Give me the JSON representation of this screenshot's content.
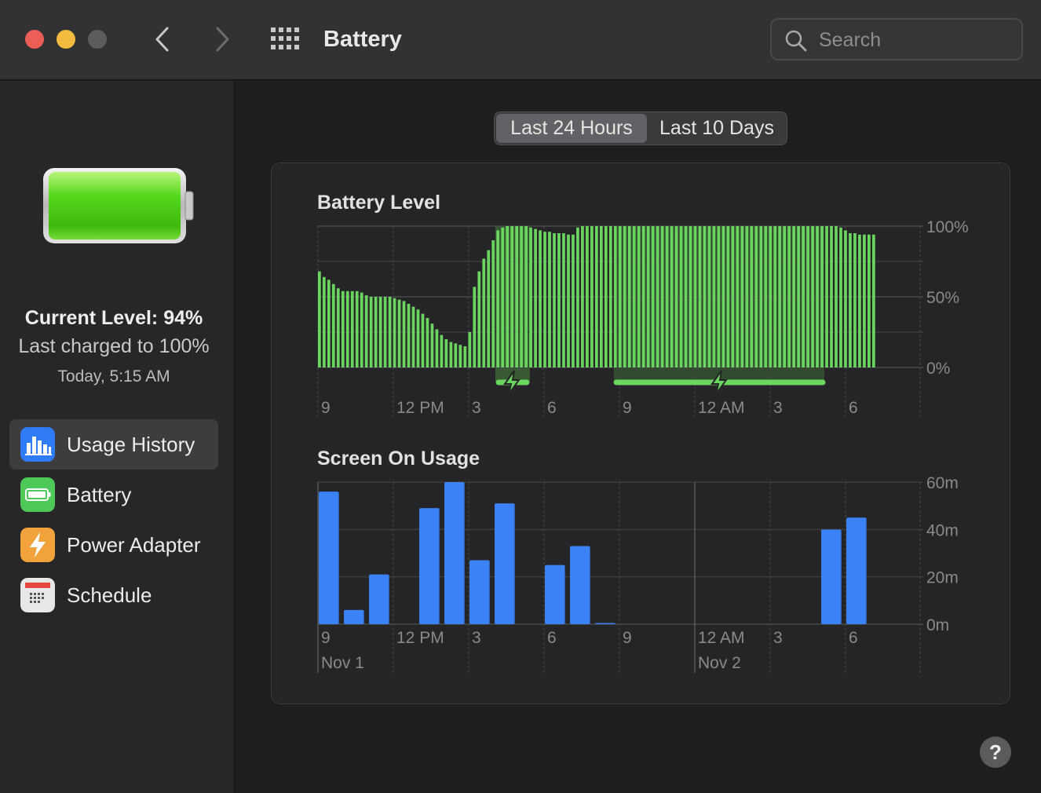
{
  "window": {
    "title": "Battery"
  },
  "search": {
    "placeholder": "Search"
  },
  "sidebar": {
    "current_level": "Current Level: 94%",
    "last_charged": "Last charged to 100%",
    "charged_time": "Today, 5:15 AM",
    "items": [
      {
        "label": "Usage History",
        "icon": "usage-history-icon",
        "active": true
      },
      {
        "label": "Battery",
        "icon": "battery-icon",
        "active": false
      },
      {
        "label": "Power Adapter",
        "icon": "power-adapter-icon",
        "active": false
      },
      {
        "label": "Schedule",
        "icon": "schedule-icon",
        "active": false
      }
    ]
  },
  "tabs": [
    {
      "label": "Last 24 Hours",
      "selected": true
    },
    {
      "label": "Last 10 Days",
      "selected": false
    }
  ],
  "help": {
    "label": "?"
  },
  "chart_data": [
    {
      "type": "bar",
      "title": "Battery Level",
      "ylabel": "",
      "ylim": [
        0,
        100
      ],
      "y_ticks": [
        "100%",
        "50%",
        "0%"
      ],
      "x_ticks": [
        "9",
        "12 PM",
        "3",
        "6",
        "9",
        "12 AM",
        "3",
        "6"
      ],
      "bar_color": "#6ad55f",
      "values": [
        68,
        64,
        62,
        59,
        56,
        54,
        54,
        54,
        54,
        53,
        51,
        50,
        50,
        50,
        50,
        50,
        49,
        48,
        47,
        45,
        43,
        41,
        38,
        35,
        31,
        27,
        23,
        20,
        18,
        17,
        16,
        15,
        25,
        57,
        68,
        77,
        83,
        90,
        97,
        99,
        100,
        100,
        100,
        100,
        100,
        99,
        98,
        97,
        96,
        96,
        95,
        95,
        95,
        94,
        94,
        99,
        100,
        100,
        100,
        100,
        100,
        100,
        100,
        100,
        100,
        100,
        100,
        100,
        100,
        100,
        100,
        100,
        100,
        100,
        100,
        100,
        100,
        100,
        100,
        100,
        100,
        100,
        100,
        100,
        100,
        100,
        100,
        100,
        100,
        100,
        100,
        100,
        100,
        100,
        100,
        100,
        100,
        100,
        100,
        100,
        100,
        100,
        100,
        100,
        100,
        100,
        100,
        100,
        100,
        100,
        100,
        99,
        97,
        95,
        95,
        94,
        94,
        94,
        94
      ]
    },
    {
      "type": "bar",
      "title": "Screen On Usage",
      "ylabel": "",
      "ylim": [
        0,
        60
      ],
      "y_ticks": [
        "60m",
        "40m",
        "20m",
        "0m"
      ],
      "x_ticks": [
        "9",
        "12 PM",
        "3",
        "6",
        "9",
        "12 AM",
        "3",
        "6"
      ],
      "date_labels": [
        "Nov 1",
        "Nov 2"
      ],
      "bar_color": "#3b82f6",
      "values": [
        56,
        6,
        21,
        0,
        49,
        60,
        27,
        51,
        0,
        25,
        33,
        0.5,
        0,
        0,
        0,
        0,
        0,
        0,
        0,
        0,
        40,
        45,
        0
      ]
    }
  ]
}
